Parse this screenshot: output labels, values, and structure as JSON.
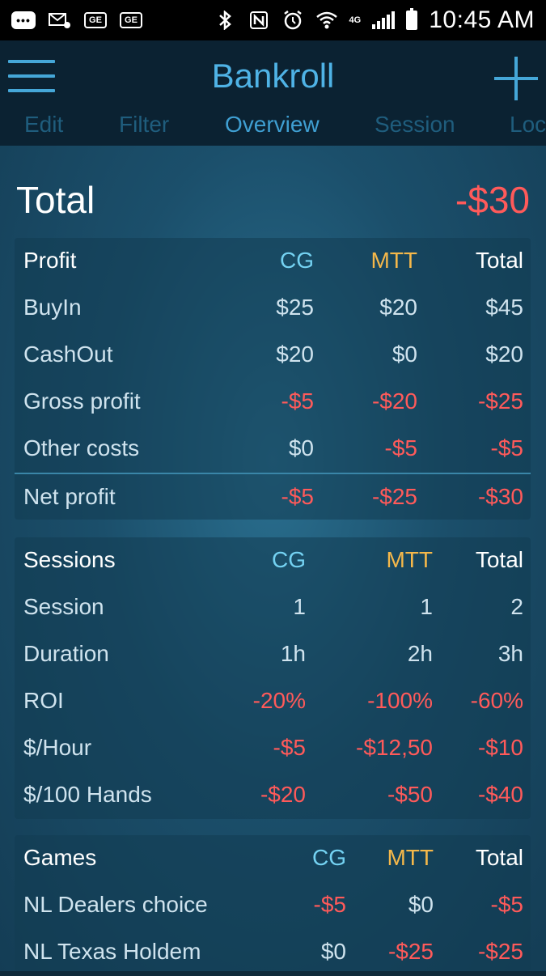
{
  "status_bar": {
    "time": "10:45 AM",
    "network": "4G",
    "icons": [
      "chat-icon",
      "voicemail-icon",
      "ge-icon",
      "ge-icon",
      "bluetooth-icon",
      "nfc-icon",
      "alarm-icon",
      "wifi-icon",
      "signal-icon",
      "battery-icon"
    ]
  },
  "app_bar": {
    "title": "Bankroll",
    "menu_icon": "hamburger-menu-icon",
    "add_icon": "plus-icon"
  },
  "tabs": [
    {
      "label": "Edit",
      "active": false
    },
    {
      "label": "Filter",
      "active": false
    },
    {
      "label": "Overview",
      "active": true
    },
    {
      "label": "Session",
      "active": false
    },
    {
      "label": "Loc",
      "active": false
    }
  ],
  "summary": {
    "label": "Total",
    "value": "-$30"
  },
  "profit_card": {
    "title": "Profit",
    "columns": [
      "CG",
      "MTT",
      "Total"
    ],
    "rows": [
      {
        "label": "BuyIn",
        "values": [
          "$25",
          "$20",
          "$45"
        ]
      },
      {
        "label": "CashOut",
        "values": [
          "$20",
          "$0",
          "$20"
        ]
      },
      {
        "label": "Gross profit",
        "values": [
          "-$5",
          "-$20",
          "-$25"
        ]
      },
      {
        "label": "Other costs",
        "values": [
          "$0",
          "-$5",
          "-$5"
        ]
      },
      {
        "label": "Net profit",
        "values": [
          "-$5",
          "-$25",
          "-$30"
        ]
      }
    ]
  },
  "sessions_card": {
    "title": "Sessions",
    "columns": [
      "CG",
      "MTT",
      "Total"
    ],
    "rows": [
      {
        "label": "Session",
        "values": [
          "1",
          "1",
          "2"
        ]
      },
      {
        "label": "Duration",
        "values": [
          "1h",
          "2h",
          "3h"
        ]
      },
      {
        "label": "ROI",
        "values": [
          "-20%",
          "-100%",
          "-60%"
        ]
      },
      {
        "label": "$/Hour",
        "values": [
          "-$5",
          "-$12,50",
          "-$10"
        ]
      },
      {
        "label": "$/100 Hands",
        "values": [
          "-$20",
          "-$50",
          "-$40"
        ]
      }
    ]
  },
  "games_card": {
    "title": "Games",
    "columns": [
      "CG",
      "MTT",
      "Total"
    ],
    "rows": [
      {
        "label": "NL Dealers choice",
        "values": [
          "-$5",
          "$0",
          "-$5"
        ]
      },
      {
        "label": "NL Texas Holdem",
        "values": [
          "$0",
          "-$25",
          "-$25"
        ]
      }
    ]
  },
  "colors": {
    "negative": "#ff5a5a",
    "cg": "#74d2f2",
    "mtt": "#f5b84a",
    "accent": "#4fb3e6"
  }
}
